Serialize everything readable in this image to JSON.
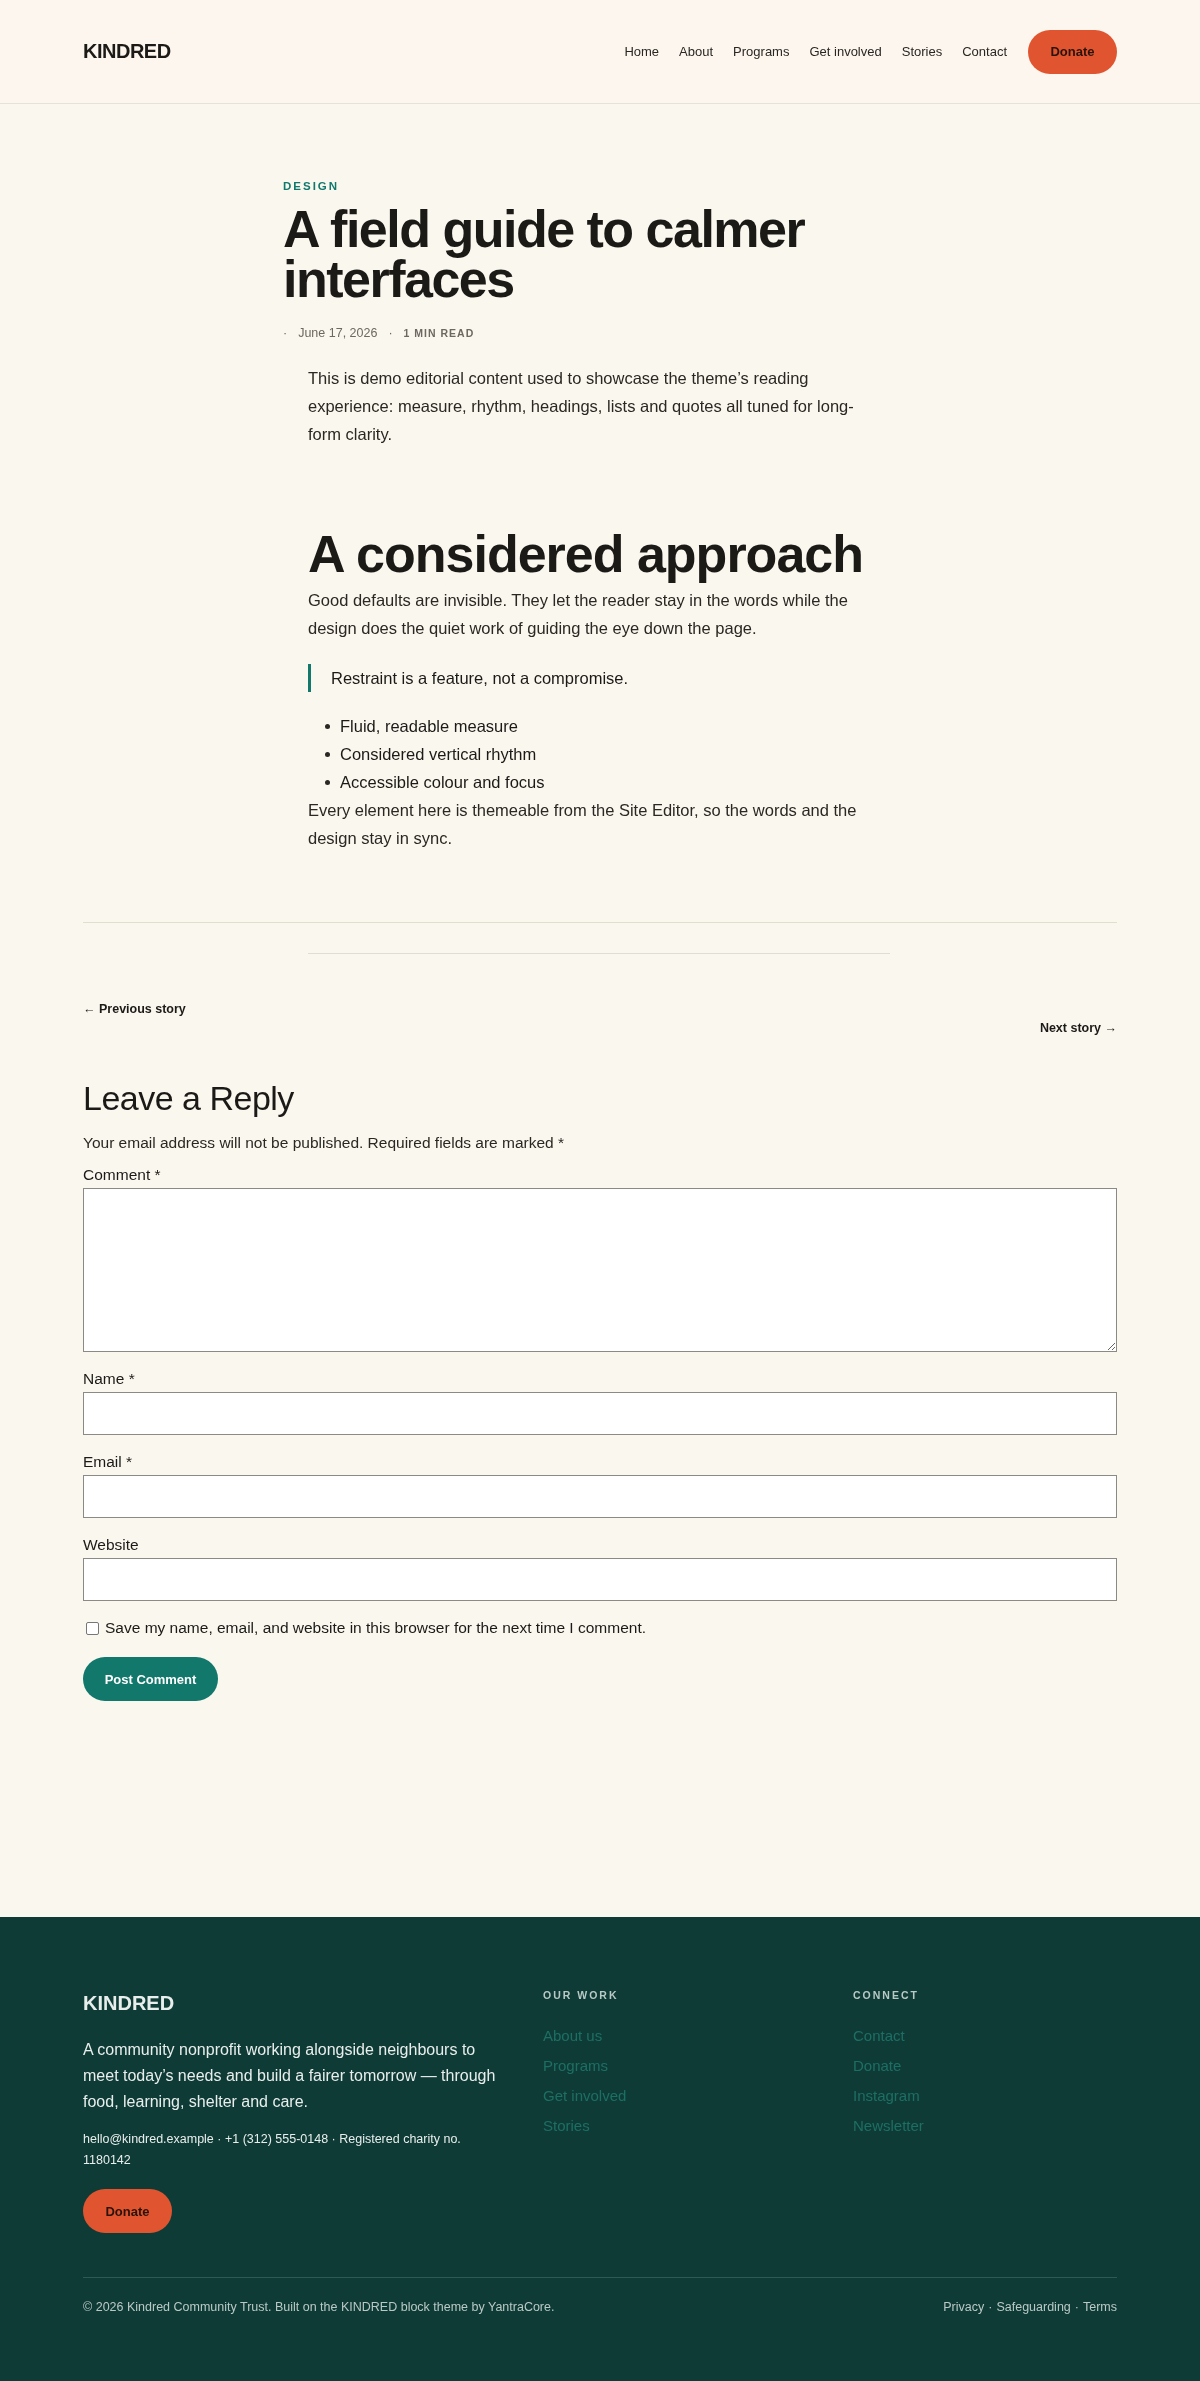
{
  "header": {
    "logo": "KINDRED",
    "nav": [
      "Home",
      "About",
      "Programs",
      "Get involved",
      "Stories",
      "Contact"
    ],
    "cta": "Donate"
  },
  "article": {
    "category": "DESIGN",
    "title": "A field guide to calmer interfaces",
    "meta": [
      {
        "kind": "sep",
        "text": "·"
      },
      {
        "kind": "date",
        "text": "June 17, 2026"
      },
      {
        "kind": "sep",
        "text": "·"
      },
      {
        "kind": "read",
        "text": "1 MIN READ"
      }
    ],
    "blocks": [
      {
        "kind": "intro",
        "text": "This is demo editorial content used to showcase the theme’s reading experience: measure, rhythm, headings, lists and quotes all tuned for long-form clarity."
      },
      {
        "kind": "heading",
        "text": "A considered approach"
      },
      {
        "kind": "paragraph",
        "text": "Good defaults are invisible. They let the reader stay in the words while the design does the quiet work of guiding the eye down the page."
      },
      {
        "kind": "quote",
        "text": "Restraint is a feature, not a compromise."
      },
      {
        "kind": "list",
        "items": [
          "Fluid, readable measure",
          "Considered vertical rhythm",
          "Accessible colour and focus"
        ]
      },
      {
        "kind": "paragraph",
        "text": "Every element here is themeable from the Site Editor, so the words and the design stay in sync."
      }
    ]
  },
  "post_nav": {
    "previous": "← Previous story",
    "next": "Next story →"
  },
  "reply": {
    "title": "Leave a Reply",
    "notice": "Your email address will not be published. Required fields are marked *",
    "fields": [
      {
        "kind": "textarea",
        "label": "Comment *"
      },
      {
        "kind": "input",
        "label": "Name *"
      },
      {
        "kind": "input",
        "label": "Email *"
      },
      {
        "kind": "input",
        "label": "Website"
      }
    ],
    "consent": {
      "label": "Save my name, email, and website in this browser for the next time I comment.",
      "checked": false
    },
    "submit": "Post Comment"
  },
  "footer": {
    "logo": "KINDRED",
    "about": "A community nonprofit working alongside neighbours to meet today’s needs and build a fairer tomorrow — through food, learning, shelter and care.",
    "contact": "hello@kindred.example · +1 (312) 555-0148 · Registered charity no. 1180142",
    "cta": "Donate",
    "columns": [
      {
        "title": "OUR WORK",
        "links": [
          "About us",
          "Programs",
          "Get involved",
          "Stories"
        ]
      },
      {
        "title": "CONNECT",
        "links": [
          "Contact",
          "Donate",
          "Instagram",
          "Newsletter"
        ]
      }
    ],
    "copyright": "© 2026 Kindred Community Trust. Built on the KINDRED block theme by YantraCore.",
    "legal": [
      "Privacy",
      "Safeguarding",
      "Terms"
    ],
    "legal_separator": "·"
  }
}
